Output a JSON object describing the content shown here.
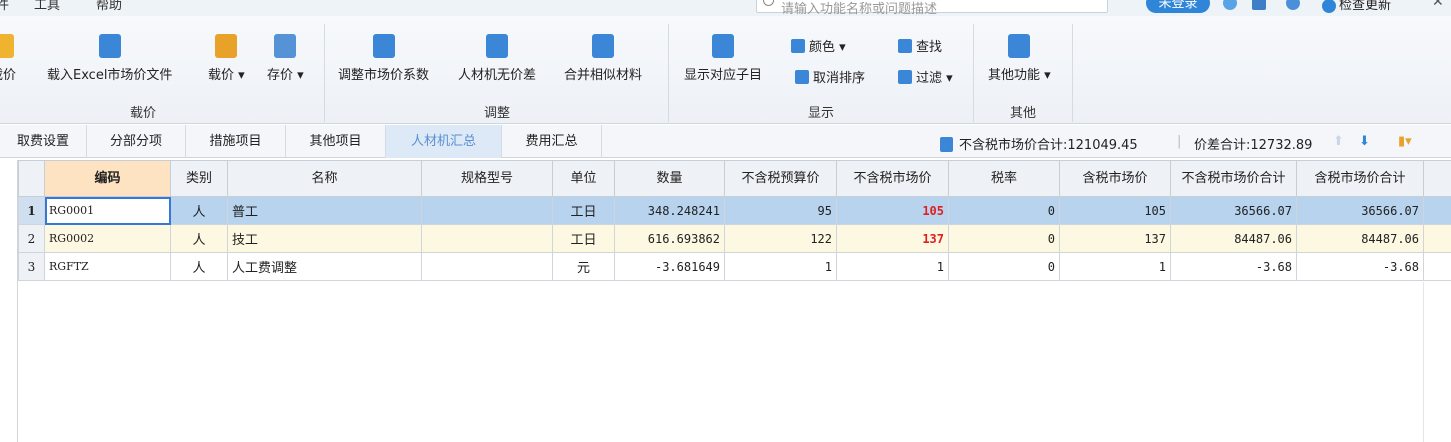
{
  "menu": {
    "items": [
      "件",
      "工具",
      "帮助"
    ]
  },
  "search": {
    "placeholder": "请输入功能名称或问题描述"
  },
  "account": {
    "login_label": "未登录",
    "check_update_label": "检查更新"
  },
  "ribbon": {
    "groups": [
      {
        "label": "载价",
        "buttons": [
          "载价",
          "载入Excel市场价文件",
          "载价",
          "存价"
        ]
      },
      {
        "label": "调整",
        "buttons": [
          "调整市场价系数",
          "人材机无价差",
          "合并相似材料"
        ]
      },
      {
        "label": "显示",
        "buttons": [
          "显示对应子目"
        ],
        "small": [
          "颜色",
          "取消排序",
          "查找",
          "过滤"
        ]
      },
      {
        "label": "其他",
        "buttons": [
          "其他功能"
        ]
      }
    ]
  },
  "tabs": [
    "取费设置",
    "分部分项",
    "措施项目",
    "其他项目",
    "人材机汇总",
    "费用汇总"
  ],
  "active_tab": "人材机汇总",
  "totals": {
    "market_no_tax": "不含税市场价合计:121049.45",
    "price_diff": "价差合计:12732.89"
  },
  "table": {
    "columns": [
      "编码",
      "类别",
      "名称",
      "规格型号",
      "单位",
      "数量",
      "不含税预算价",
      "不含税市场价",
      "税率",
      "含税市场价",
      "不含税市场价合计",
      "含税市场价合计"
    ],
    "rows": [
      {
        "no": "1",
        "code": "RG0001",
        "type": "人",
        "name": "普工",
        "spec": "",
        "unit": "工日",
        "qty": "348.248241",
        "budget": "95",
        "market": "105",
        "tax": "0",
        "market_tax": "105",
        "total_no_tax": "36566.07",
        "total_tax": "36566.07"
      },
      {
        "no": "2",
        "code": "RG0002",
        "type": "人",
        "name": "技工",
        "spec": "",
        "unit": "工日",
        "qty": "616.693862",
        "budget": "122",
        "market": "137",
        "tax": "0",
        "market_tax": "137",
        "total_no_tax": "84487.06",
        "total_tax": "84487.06"
      },
      {
        "no": "3",
        "code": "RGFTZ",
        "type": "人",
        "name": "人工费调整",
        "spec": "",
        "unit": "元",
        "qty": "-3.681649",
        "budget": "1",
        "market": "1",
        "tax": "0",
        "market_tax": "1",
        "total_no_tax": "-3.68",
        "total_tax": "-3.68"
      }
    ]
  },
  "colors": {
    "accent": "#2f86d8",
    "market_price_red": "#e02020",
    "selected_row": "#b8d3ee",
    "header_highlight": "#fde3c2"
  }
}
